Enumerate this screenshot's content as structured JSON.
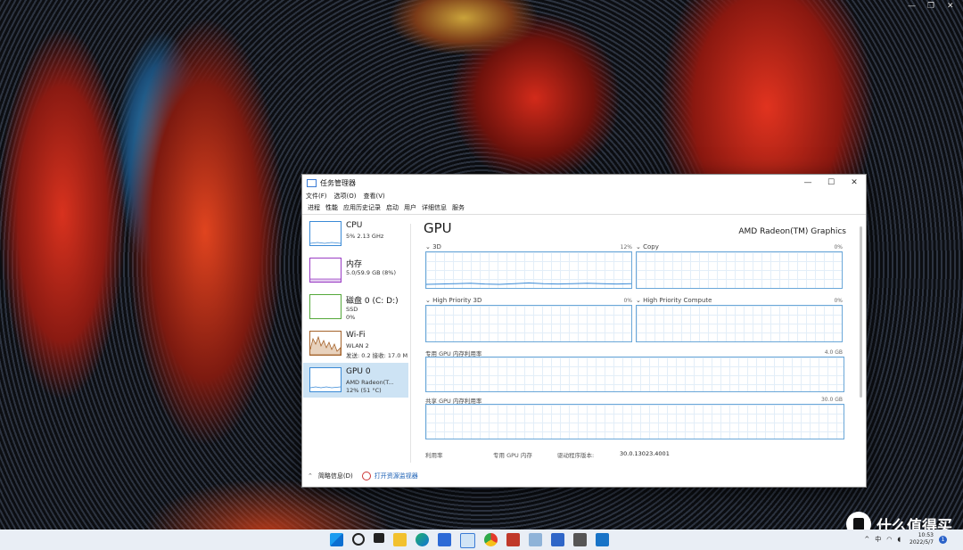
{
  "window": {
    "title": "任务管理器",
    "controls": {
      "minimize": "—",
      "maximize": "☐",
      "close": "✕"
    }
  },
  "menu": [
    "文件(F)",
    "选项(O)",
    "查看(V)"
  ],
  "tabs": [
    "进程",
    "性能",
    "应用历史记录",
    "启动",
    "用户",
    "详细信息",
    "服务"
  ],
  "active_tab": "性能",
  "sidebar": [
    {
      "name": "CPU",
      "line1": "5% 2.13 GHz",
      "line2": "",
      "color": "#3a8ad6"
    },
    {
      "name": "内存",
      "line1": "5.0/59.9 GB (8%)",
      "line2": "",
      "color": "#9a3cc4"
    },
    {
      "name": "磁盘 0 (C: D:)",
      "line1": "SSD",
      "line2": "0%",
      "color": "#54a83a"
    },
    {
      "name": "Wi-Fi",
      "line1": "WLAN 2",
      "line2": "发送: 0.2  接收: 17.0 M",
      "color": "#a4622a"
    },
    {
      "name": "GPU 0",
      "line1": "AMD Radeon(T...",
      "line2": "12% (51 °C)",
      "color": "#3a8ad6"
    }
  ],
  "main": {
    "title": "GPU",
    "model": "AMD Radeon(TM) Graphics",
    "graphs": [
      {
        "label": "3D",
        "pct": "12%"
      },
      {
        "label": "Copy",
        "pct": "0%"
      },
      {
        "label": "High Priority 3D",
        "pct": "0%"
      },
      {
        "label": "High Priority Compute",
        "pct": "0%"
      }
    ],
    "dedicated": {
      "label": "专用 GPU 内存利用率",
      "max": "4.0 GB"
    },
    "shared": {
      "label": "共享 GPU 内存利用率",
      "max": "30.0 GB"
    },
    "stats": {
      "utilization": "利用率",
      "dedicated_mem": "专用 GPU 内存",
      "driver_version_label": "驱动程序版本:",
      "driver_version": "30.0.13023.4001"
    }
  },
  "footer": {
    "brief": "简略信息(D)",
    "open_monitor": "打开资源监视器"
  },
  "chart_data": {
    "type": "line",
    "series": [
      {
        "name": "3D",
        "values": [
          10,
          11,
          12,
          13,
          11,
          10,
          12,
          14,
          12,
          11,
          12,
          13,
          12,
          11,
          12
        ]
      }
    ],
    "ylim": [
      0,
      100
    ]
  },
  "taskbar": {
    "icons": [
      "windows-start",
      "search",
      "task-view",
      "file-explorer",
      "edge",
      "store",
      "task-manager",
      "chrome",
      "aida64",
      "remote",
      "game",
      "tool",
      "app"
    ],
    "tray": {
      "expand": "^",
      "ime": "中"
    },
    "clock": {
      "time": "10:53",
      "date": "2022/5/7"
    },
    "notifications": "1"
  },
  "watermark": "什么值得买"
}
